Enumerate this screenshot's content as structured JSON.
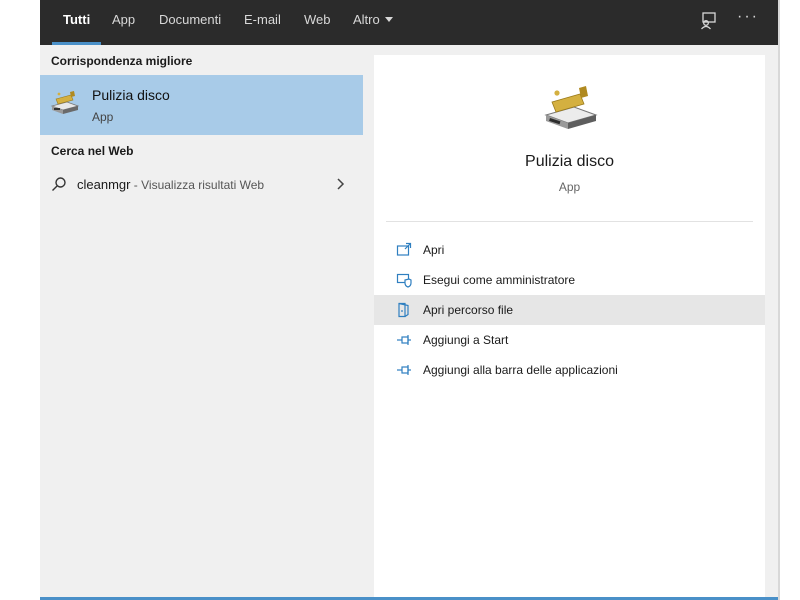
{
  "tabs": [
    {
      "label": "Tutti",
      "active": true
    },
    {
      "label": "App"
    },
    {
      "label": "Documenti"
    },
    {
      "label": "E-mail"
    },
    {
      "label": "Web"
    },
    {
      "label": "Altro"
    }
  ],
  "top_icons": {
    "feedback": "feedback-icon",
    "more": "···"
  },
  "left": {
    "best_match_heading": "Corrispondenza migliore",
    "best_match": {
      "title": "Pulizia disco",
      "subtitle": "App",
      "icon": "disk-cleanup-icon"
    },
    "web_heading": "Cerca nel Web",
    "web_item": {
      "query": "cleanmgr",
      "suffix": " - Visualizza risultati Web"
    }
  },
  "preview": {
    "title": "Pulizia disco",
    "subtitle": "App",
    "actions": [
      {
        "label": "Apri",
        "icon": "open-icon"
      },
      {
        "label": "Esegui come amministratore",
        "icon": "run-as-admin-icon"
      },
      {
        "label": "Apri percorso file",
        "icon": "file-location-icon",
        "highlighted": true
      },
      {
        "label": "Aggiungi a Start",
        "icon": "pin-icon"
      },
      {
        "label": "Aggiungi alla barra delle applicazioni",
        "icon": "pin-icon"
      }
    ]
  },
  "colors": {
    "accent": "#4a90c8",
    "selection": "#a8cbe8",
    "topbar": "#2b2b2b"
  }
}
